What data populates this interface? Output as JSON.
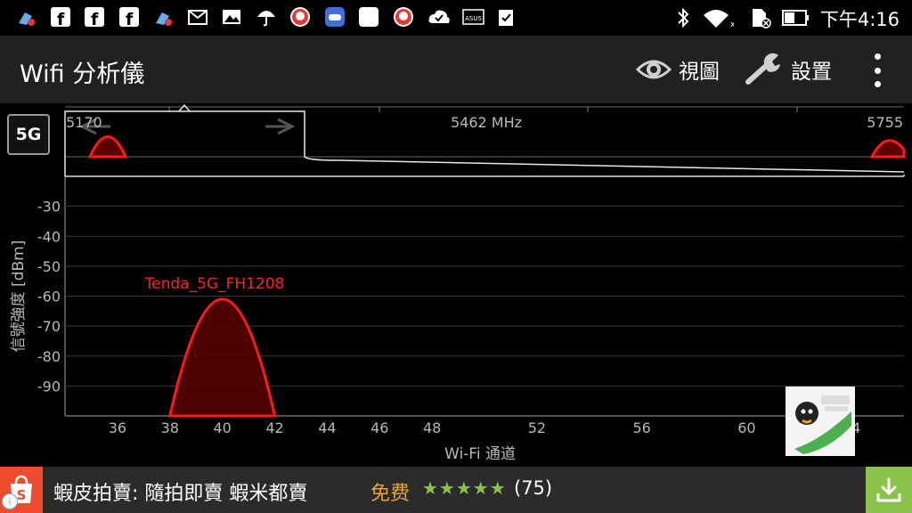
{
  "status_bar": {
    "time": "下午4:16",
    "notification_icons": [
      "broom-alert-icon",
      "facebook-icon",
      "facebook-icon",
      "facebook-icon",
      "broom-alert-icon",
      "gmail-icon",
      "image-icon",
      "umbrella-icon",
      "avatar-alert-icon",
      "gamepad-icon",
      "blank-app-icon",
      "avatar-alert-icon",
      "cloud-check-icon",
      "asus-icon",
      "clipboard-check-icon"
    ],
    "system_icons": [
      "bluetooth-icon",
      "wifi-icon",
      "no-sim-icon",
      "battery-icon"
    ]
  },
  "app_bar": {
    "title": "Wifi 分析儀",
    "view_label": "視圖",
    "settings_label": "設置"
  },
  "band_button": "5G",
  "overview": {
    "left_freq": "5170",
    "center_freq": "5462 MHz",
    "right_freq": "5755"
  },
  "colors": {
    "series": "#ff1a1a",
    "series_fill": "#5a0000",
    "grid": "#3a3a3a",
    "ad_accent": "#8bc34a",
    "shopee": "#ee4d2d"
  },
  "chart_data": {
    "type": "area",
    "title": "",
    "xlabel": "Wi-Fi 通道",
    "ylabel": "信號強度 [dBm]",
    "xlim": [
      34,
      66
    ],
    "ylim": [
      -100,
      -20
    ],
    "y_ticks": [
      -30,
      -40,
      -50,
      -60,
      -70,
      -80,
      -90
    ],
    "x_ticks": [
      36,
      38,
      40,
      42,
      44,
      46,
      48,
      52,
      56,
      60,
      64
    ],
    "series": [
      {
        "name": "Tenda_5G_FH1208",
        "channel": 40,
        "channel_start": 38,
        "channel_end": 42,
        "signal_dbm": -61
      }
    ]
  },
  "ad": {
    "title": "蝦皮拍賣: 隨拍即賣 蝦米都賣",
    "price": "免费",
    "rating": 4.5,
    "stars": "★★★★★",
    "review_count": "(75)"
  }
}
